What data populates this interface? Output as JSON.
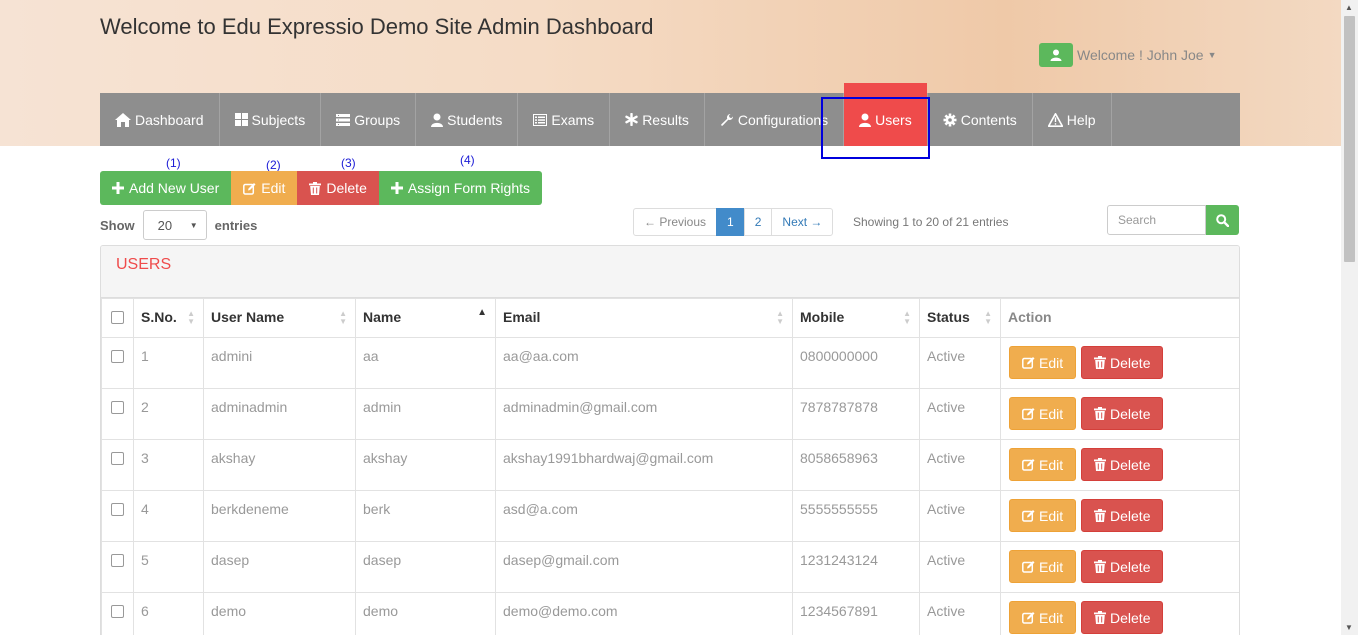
{
  "header": {
    "title": "Welcome to Edu Expressio Demo Site Admin Dashboard",
    "welcome_text": "Welcome ! John Joe"
  },
  "nav": {
    "active": "Users",
    "items": [
      {
        "label": "Dashboard",
        "icon": "home-icon"
      },
      {
        "label": "Subjects",
        "icon": "grid-icon"
      },
      {
        "label": "Groups",
        "icon": "list-icon"
      },
      {
        "label": "Students",
        "icon": "user-icon"
      },
      {
        "label": "Exams",
        "icon": "list-alt-icon"
      },
      {
        "label": "Results",
        "icon": "asterisk-icon"
      },
      {
        "label": "Configurations",
        "icon": "wrench-icon"
      },
      {
        "label": "Users",
        "icon": "user-icon"
      },
      {
        "label": "Contents",
        "icon": "gear-icon"
      },
      {
        "label": "Help",
        "icon": "warning-icon"
      }
    ]
  },
  "annotations": [
    "(1)",
    "(2)",
    "(3)",
    "(4)"
  ],
  "actions": {
    "add_new_user": "Add New User",
    "edit": "Edit",
    "delete": "Delete",
    "assign_form_rights": "Assign Form Rights"
  },
  "length": {
    "show": "Show",
    "value": "20",
    "entries": "entries"
  },
  "pagination": {
    "previous": "← Previous",
    "pages": [
      "1",
      "2"
    ],
    "current": "1",
    "next": "Next →",
    "info": "Showing 1 to 20 of 21 entries"
  },
  "search": {
    "placeholder": "Search"
  },
  "panel": {
    "title": "USERS"
  },
  "table": {
    "columns": [
      "S.No.",
      "User Name",
      "Name",
      "Email",
      "Mobile",
      "Status",
      "Action"
    ],
    "sorted_column": "Name",
    "rows": [
      {
        "sno": "1",
        "username": "admini",
        "name": "aa",
        "email": "aa@aa.com",
        "mobile": "0800000000",
        "status": "Active"
      },
      {
        "sno": "2",
        "username": "adminadmin",
        "name": "admin",
        "email": "adminadmin@gmail.com",
        "mobile": "7878787878",
        "status": "Active"
      },
      {
        "sno": "3",
        "username": "akshay",
        "name": "akshay",
        "email": "akshay1991bhardwaj@gmail.com",
        "mobile": "8058658963",
        "status": "Active"
      },
      {
        "sno": "4",
        "username": "berkdeneme",
        "name": "berk",
        "email": "asd@a.com",
        "mobile": "5555555555",
        "status": "Active"
      },
      {
        "sno": "5",
        "username": "dasep",
        "name": "dasep",
        "email": "dasep@gmail.com",
        "mobile": "1231243124",
        "status": "Active"
      },
      {
        "sno": "6",
        "username": "demo",
        "name": "demo",
        "email": "demo@demo.com",
        "mobile": "1234567891",
        "status": "Active"
      }
    ],
    "row_edit_label": "Edit",
    "row_delete_label": "Delete"
  },
  "colors": {
    "active_nav": "#ef4b4b",
    "nav_bg": "#8e8e8e",
    "success": "#5cb85c",
    "warning": "#f0ad4e",
    "danger": "#d9534f",
    "highlight_box": "#0000dd",
    "annotation": "#1a1ad6"
  }
}
